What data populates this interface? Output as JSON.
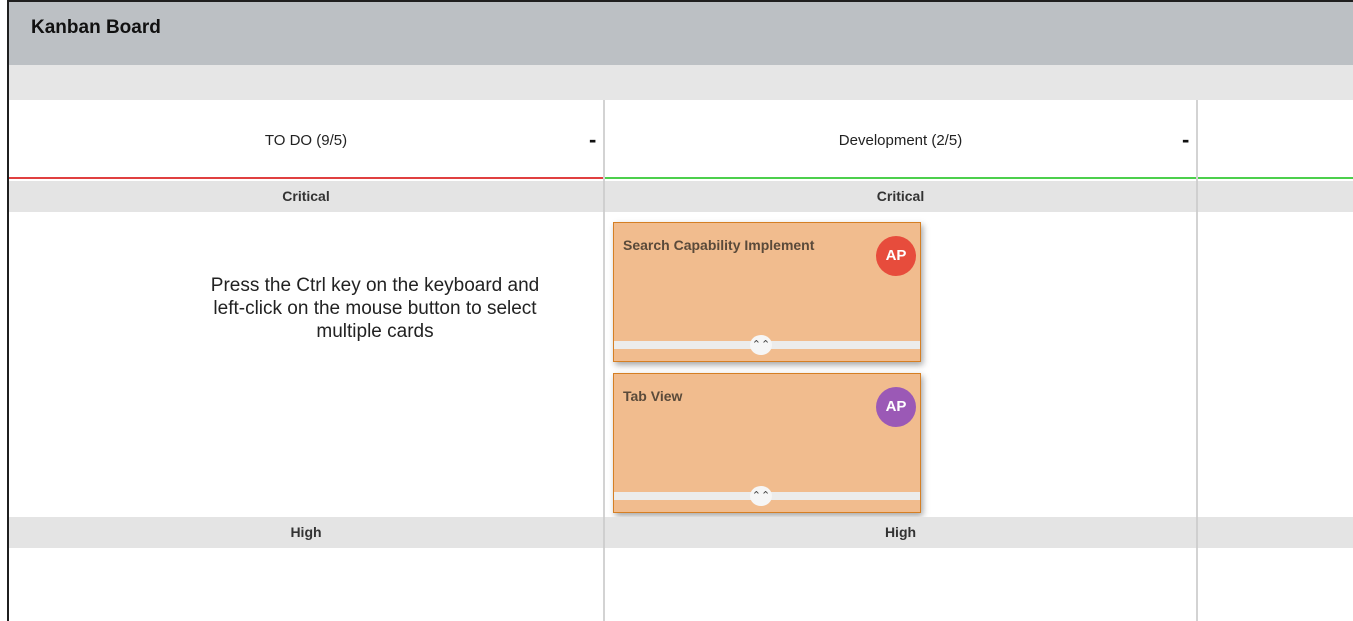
{
  "window": {
    "title": "Kanban Board"
  },
  "columns": [
    {
      "label": "TO DO (9/5)",
      "collapse_label": "-"
    },
    {
      "label": "Development (2/5)",
      "collapse_label": "-"
    }
  ],
  "swimlanes": [
    {
      "label": "Critical"
    },
    {
      "label": "High"
    }
  ],
  "hint_text": "Press the Ctrl key on the keyboard and left-click on the mouse button to select multiple cards",
  "cards": [
    {
      "title": "Search Capability Implement",
      "assignee_initials": "AP",
      "avatar_color": "#e74c3c",
      "expand_icon": "double-chevron-up-icon"
    },
    {
      "title": "Tab View",
      "assignee_initials": "AP",
      "avatar_color": "#9b59b6",
      "expand_icon": "double-chevron-up-icon"
    }
  ],
  "colors": {
    "title_bar": "#bcc0c4",
    "card_background": "#f1bc8e",
    "card_border": "#d57f24",
    "todo_underline": "#e04040",
    "dev_underline": "#4ccf4c"
  }
}
